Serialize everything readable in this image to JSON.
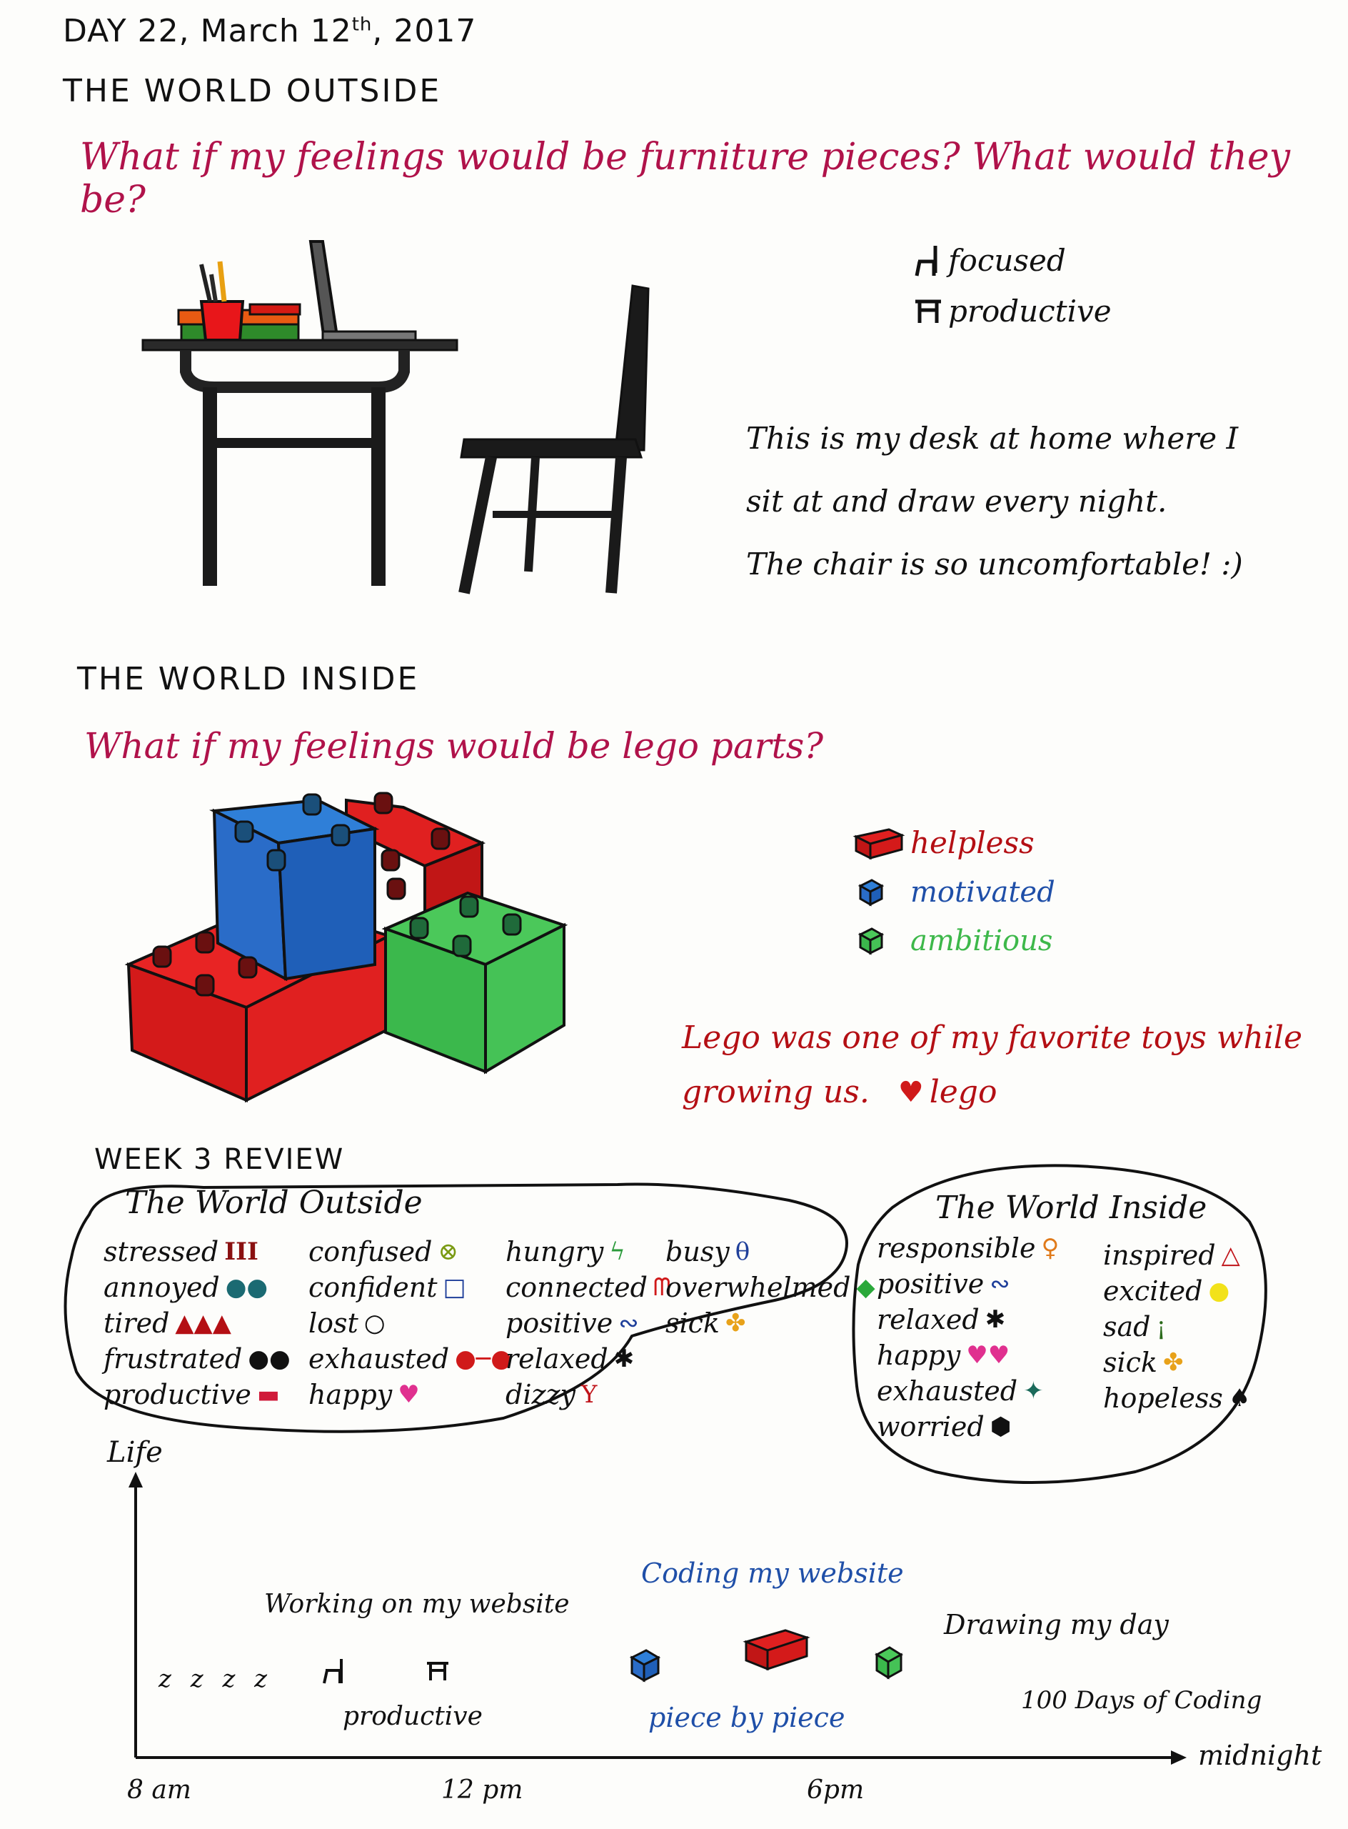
{
  "header": {
    "day": "DAY 22, March 12",
    "day_sup": "th",
    "year": ", 2017"
  },
  "outside": {
    "title": "THE WORLD OUTSIDE",
    "question": "What if my feelings would be furniture pieces? What would they be?",
    "legend": [
      {
        "icon": "chair-symbol-icon",
        "label": "focused"
      },
      {
        "icon": "desk-symbol-icon",
        "label": "productive"
      }
    ],
    "note_lines": [
      "This is my desk at home where I",
      "sit at and draw every night.",
      "The chair is so uncomfortable! :)"
    ]
  },
  "inside": {
    "title": "THE WORLD INSIDE",
    "question": "What if my feelings would be lego parts?",
    "legend": [
      {
        "icon": "red-brick-icon",
        "label": "helpless",
        "color": "#c1121a"
      },
      {
        "icon": "blue-brick-icon",
        "label": "motivated",
        "color": "#1f4fa8"
      },
      {
        "icon": "green-brick-icon",
        "label": "ambitious",
        "color": "#3db84a"
      }
    ],
    "note_line1": "Lego was one of my favorite toys while",
    "note_line2": "growing us.",
    "love": "lego"
  },
  "review": {
    "title": "WEEK 3 REVIEW",
    "outside_title": "The World Outside",
    "outside_cols": [
      [
        {
          "label": "stressed",
          "sym": "III",
          "color": "#8a1010"
        },
        {
          "label": "annoyed",
          "sym": "●●",
          "color": "#1b6a72"
        },
        {
          "label": "tired",
          "sym": "▲▲▲",
          "color": "#b40f14"
        },
        {
          "label": "frustrated",
          "sym": "●●",
          "color": "#111111"
        },
        {
          "label": "productive",
          "sym": "▬",
          "color": "#d01a3a"
        }
      ],
      [
        {
          "label": "confused",
          "sym": "⊗",
          "color": "#7a9a12"
        },
        {
          "label": "confident",
          "sym": "□",
          "color": "#1f3f9a"
        },
        {
          "label": "lost",
          "sym": "○",
          "color": "#111111"
        },
        {
          "label": "exhausted",
          "sym": "●─●",
          "color": "#d01a1a"
        },
        {
          "label": "happy",
          "sym": "♥",
          "color": "#e0308f"
        }
      ],
      [
        {
          "label": "hungry",
          "sym": "ϟ",
          "color": "#2a9a3a"
        },
        {
          "label": "connected",
          "sym": "ᗰ",
          "color": "#d01a1a"
        },
        {
          "label": "positive",
          "sym": "∾",
          "color": "#1f3f9a"
        },
        {
          "label": "relaxed",
          "sym": "✱",
          "color": "#111111"
        },
        {
          "label": "dizzy",
          "sym": "Y",
          "color": "#c0141a"
        }
      ],
      [
        {
          "label": "busy",
          "sym": "θ",
          "color": "#1f3f9a"
        },
        {
          "label": "overwhelmed",
          "sym": "◆",
          "color": "#2aa83a"
        },
        {
          "label": "sick",
          "sym": "✤",
          "color": "#e8a21a"
        }
      ]
    ],
    "inside_title": "The World Inside",
    "inside_cols": [
      [
        {
          "label": "responsible",
          "sym": "♀",
          "color": "#e07a1a"
        },
        {
          "label": "positive",
          "sym": "∾",
          "color": "#1f3f9a"
        },
        {
          "label": "relaxed",
          "sym": "✱",
          "color": "#111111"
        },
        {
          "label": "happy",
          "sym": "♥♥",
          "color": "#e0308f"
        },
        {
          "label": "exhausted",
          "sym": "✦",
          "color": "#1b6a5a"
        },
        {
          "label": "worried",
          "sym": "⬢",
          "color": "#111111"
        }
      ],
      [
        {
          "label": "inspired",
          "sym": "△",
          "color": "#c0141a"
        },
        {
          "label": "excited",
          "sym": "●",
          "color": "#f2e21a"
        },
        {
          "label": "sad",
          "sym": "¡",
          "color": "#2a6a1a"
        },
        {
          "label": "sick",
          "sym": "✤",
          "color": "#e8a21a"
        },
        {
          "label": "hopeless",
          "sym": "♠",
          "color": "#111111"
        }
      ]
    ]
  },
  "timeline": {
    "y_label": "Life",
    "x_ticks": [
      "8 am",
      "12 pm",
      "6pm"
    ],
    "x_end": "midnight",
    "sleep": "z z z z",
    "working": "Working on my website",
    "productive": "productive",
    "coding": "Coding my website",
    "piece": "piece by piece",
    "drawing": "Drawing my day",
    "hundred": "100 Days of Coding"
  }
}
